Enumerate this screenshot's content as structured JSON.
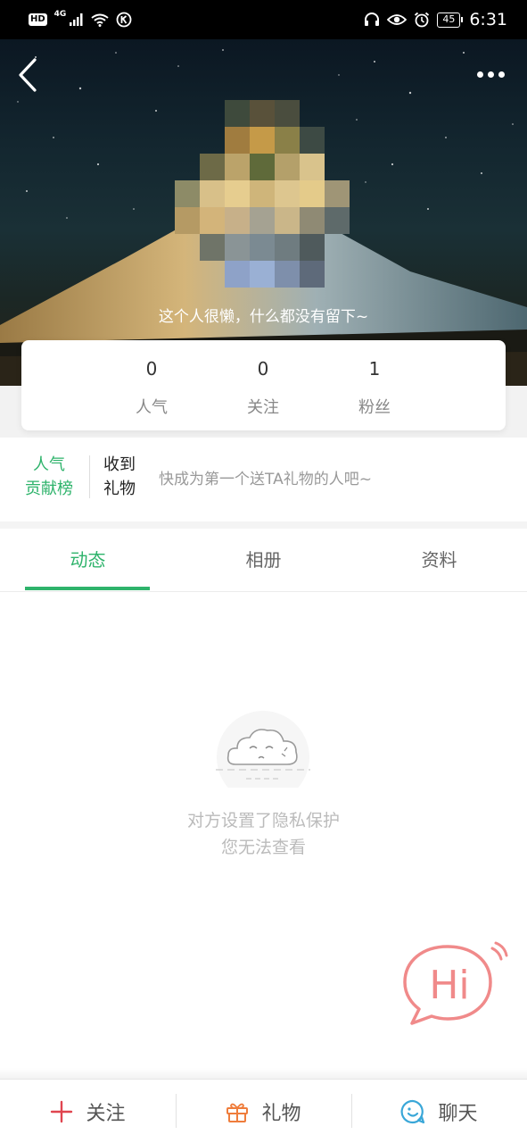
{
  "status_bar": {
    "hd": "HD",
    "network": "4G",
    "battery": "45",
    "time": "6:31",
    "icons": [
      "signal-icon",
      "wifi-icon",
      "k-icon",
      "headphones-icon",
      "eye-icon",
      "alarm-icon",
      "battery-icon"
    ]
  },
  "profile": {
    "bio": "这个人很懒，什么都没有留下~",
    "stats": [
      {
        "value": "0",
        "label": "人气"
      },
      {
        "value": "0",
        "label": "关注"
      },
      {
        "value": "1",
        "label": "粉丝"
      }
    ]
  },
  "gifts": {
    "rank_line1": "人气",
    "rank_line2": "贡献榜",
    "received_line1": "收到",
    "received_line2": "礼物",
    "hint": "快成为第一个送TA礼物的人吧~"
  },
  "tabs": [
    {
      "label": "动态",
      "active": true
    },
    {
      "label": "相册",
      "active": false
    },
    {
      "label": "资料",
      "active": false
    }
  ],
  "empty_state": {
    "line1": "对方设置了隐私保护",
    "line2": "您无法查看"
  },
  "hi_button": {
    "label": "Hi"
  },
  "bottom_bar": [
    {
      "label": "关注",
      "icon": "plus-icon"
    },
    {
      "label": "礼物",
      "icon": "gift-icon"
    },
    {
      "label": "聊天",
      "icon": "chat-icon"
    }
  ],
  "colors": {
    "accent": "#2eb36b",
    "hi_pink": "#f08a8a",
    "follow_red": "#e0454f",
    "gift_orange": "#ef7d3c",
    "chat_blue": "#3aa7d8"
  }
}
